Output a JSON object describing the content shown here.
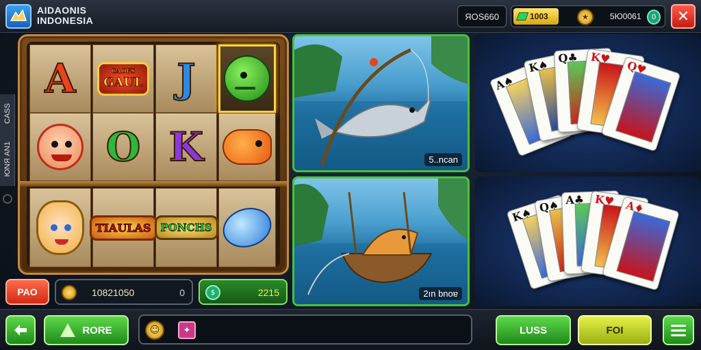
{
  "header": {
    "logo_line1": "AIDAONIS",
    "logo_line2": "INDONESIA",
    "player_id": "ЯОЅ660",
    "coins": "1003",
    "balance": "5Ю0061",
    "balance_badge": "0"
  },
  "side_tab": {
    "label1": "CAЅЅ",
    "label2": "ЮNЯ AN1"
  },
  "slot": {
    "symbols": [
      "A",
      "GAUL",
      "J",
      "fish-green",
      "clown",
      "O",
      "K",
      "fish-orange",
      "cat-girl",
      "TIAULAS",
      "PONCHS",
      "ufo-blue"
    ],
    "badge_top_small": "CAOFS",
    "colors": {
      "A": "#e8431c",
      "J": "#2c8ae6",
      "O": "#2cb83a",
      "K": "#8a3ad8"
    }
  },
  "fishing": {
    "panel1_label": "5..ncan",
    "panel2_label": "2ın bnoɐ"
  },
  "bottom_info": {
    "pao_label": "PAO",
    "balance_value": "10821050",
    "balance_extra": "0",
    "win_value": "2215"
  },
  "bottom_bar": {
    "more_label": "RORE",
    "loss_label": "LUSS",
    "fol_label": "FOI"
  },
  "icons": {
    "back": "back-arrow-icon",
    "menu": "hamburger-icon",
    "close": "close-icon"
  }
}
